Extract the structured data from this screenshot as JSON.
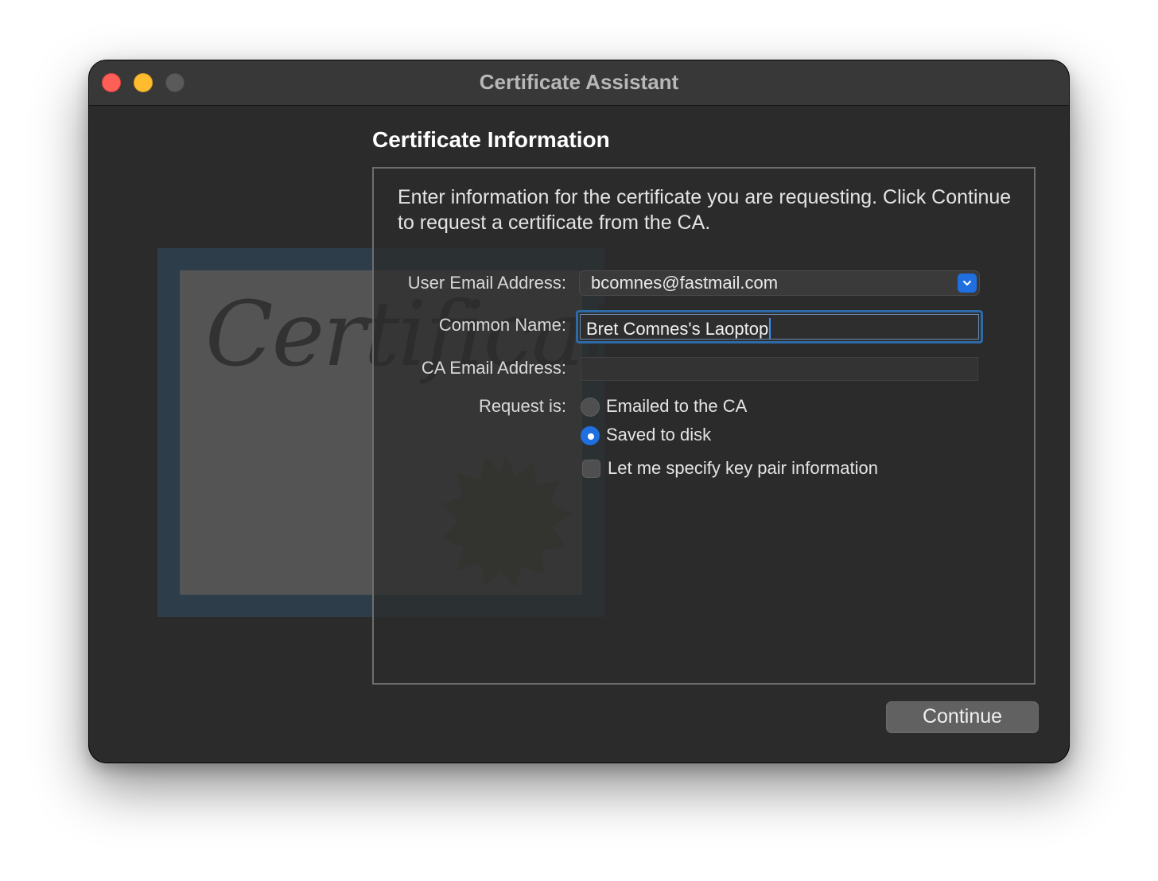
{
  "window": {
    "title": "Certificate Assistant"
  },
  "artwork": {
    "script_text": "Certificate",
    "icon": "certificate-icon"
  },
  "heading": "Certificate Information",
  "intro": "Enter information for the certificate you are requesting. Click Continue to request a certificate from the CA.",
  "form": {
    "user_email": {
      "label": "User Email Address:",
      "value": "bcomnes@fastmail.com",
      "icon": "chevron-down-icon"
    },
    "common_name": {
      "label": "Common Name:",
      "value": "Bret Comnes's Laoptop"
    },
    "ca_email": {
      "label": "CA Email Address:",
      "value": ""
    },
    "request": {
      "label": "Request is:",
      "options": [
        {
          "label": "Emailed to the CA",
          "selected": false
        },
        {
          "label": "Saved to disk",
          "selected": true
        }
      ]
    },
    "key_pair": {
      "label": "Let me specify key pair information",
      "checked": false
    }
  },
  "buttons": {
    "continue": "Continue"
  },
  "colors": {
    "accent": "#1f6fe0",
    "close": "#ff5f57",
    "minimize": "#febc2e",
    "window_bg": "#2b2b2b"
  }
}
